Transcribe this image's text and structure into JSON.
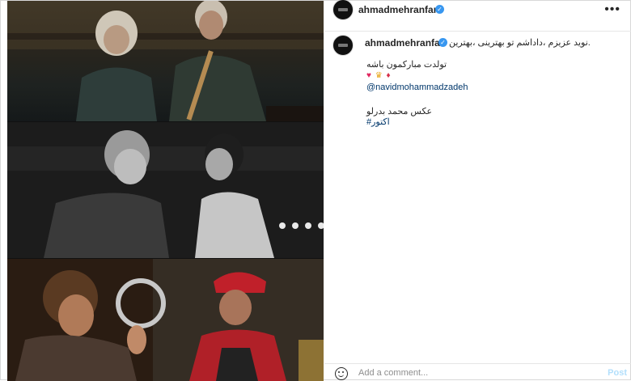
{
  "post": {
    "username": "ahmadmehranfar",
    "verified_mark": "✓",
    "more_label": "•••",
    "caption": {
      "username": "ahmadmehranfar",
      "line1": ".نوید عزیزم ،داداشم تو بهترینی ،بهترین",
      "line2": "تولدت مبارکمون باشه",
      "emojis": [
        "♥",
        "♛",
        "♦"
      ],
      "mention": "@navidmohammadzadeh",
      "line3": "عکس محمد بدرلو",
      "hashtag": "اکتور#"
    }
  },
  "comment_box": {
    "placeholder": "Add a comment...",
    "post_label": "Post"
  },
  "colors": {
    "verified": "#3897f0",
    "link": "#00376b",
    "post_disabled": "#b2dffc"
  },
  "icons": {
    "emoji": "smiley-face-icon",
    "more": "more-options-icon",
    "verified": "verified-badge-icon"
  }
}
